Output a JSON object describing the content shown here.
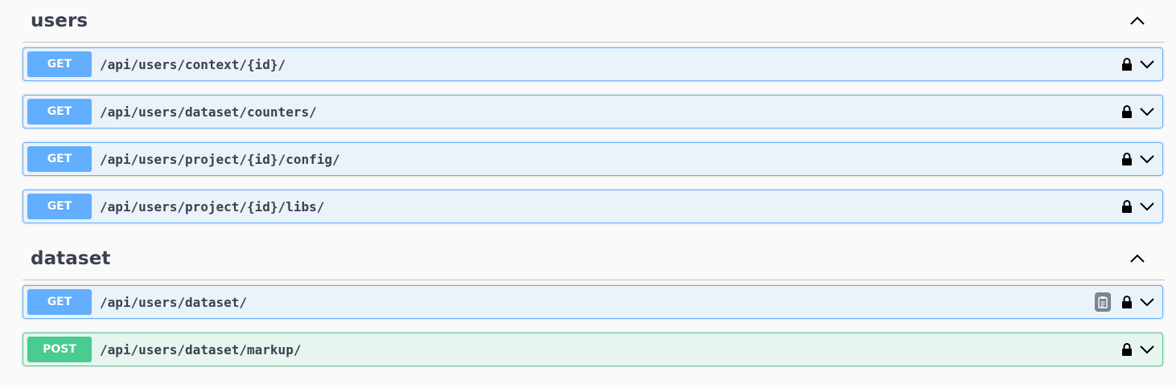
{
  "sections": [
    {
      "title": "users",
      "toggle_icon": "chevron-up-icon",
      "operations": [
        {
          "method": "GET",
          "path": "/api/users/context/{id}/"
        },
        {
          "method": "GET",
          "path": "/api/users/dataset/counters/"
        },
        {
          "method": "GET",
          "path": "/api/users/project/{id}/config/"
        },
        {
          "method": "GET",
          "path": "/api/users/project/{id}/libs/"
        }
      ]
    },
    {
      "title": "dataset",
      "toggle_icon": "chevron-up-icon",
      "operations": [
        {
          "method": "GET",
          "path": "/api/users/dataset/",
          "has_copy_button": true
        },
        {
          "method": "POST",
          "path": "/api/users/dataset/markup/"
        }
      ]
    }
  ],
  "colors": {
    "get": "#61affe",
    "post": "#49cc90",
    "text": "#3b4151",
    "background": "#fafafa",
    "copy_button": "#7d8492"
  },
  "icons": {
    "lock": "lock-icon",
    "expand": "chevron-down-icon",
    "collapse": "chevron-up-icon",
    "copy": "clipboard-icon"
  }
}
